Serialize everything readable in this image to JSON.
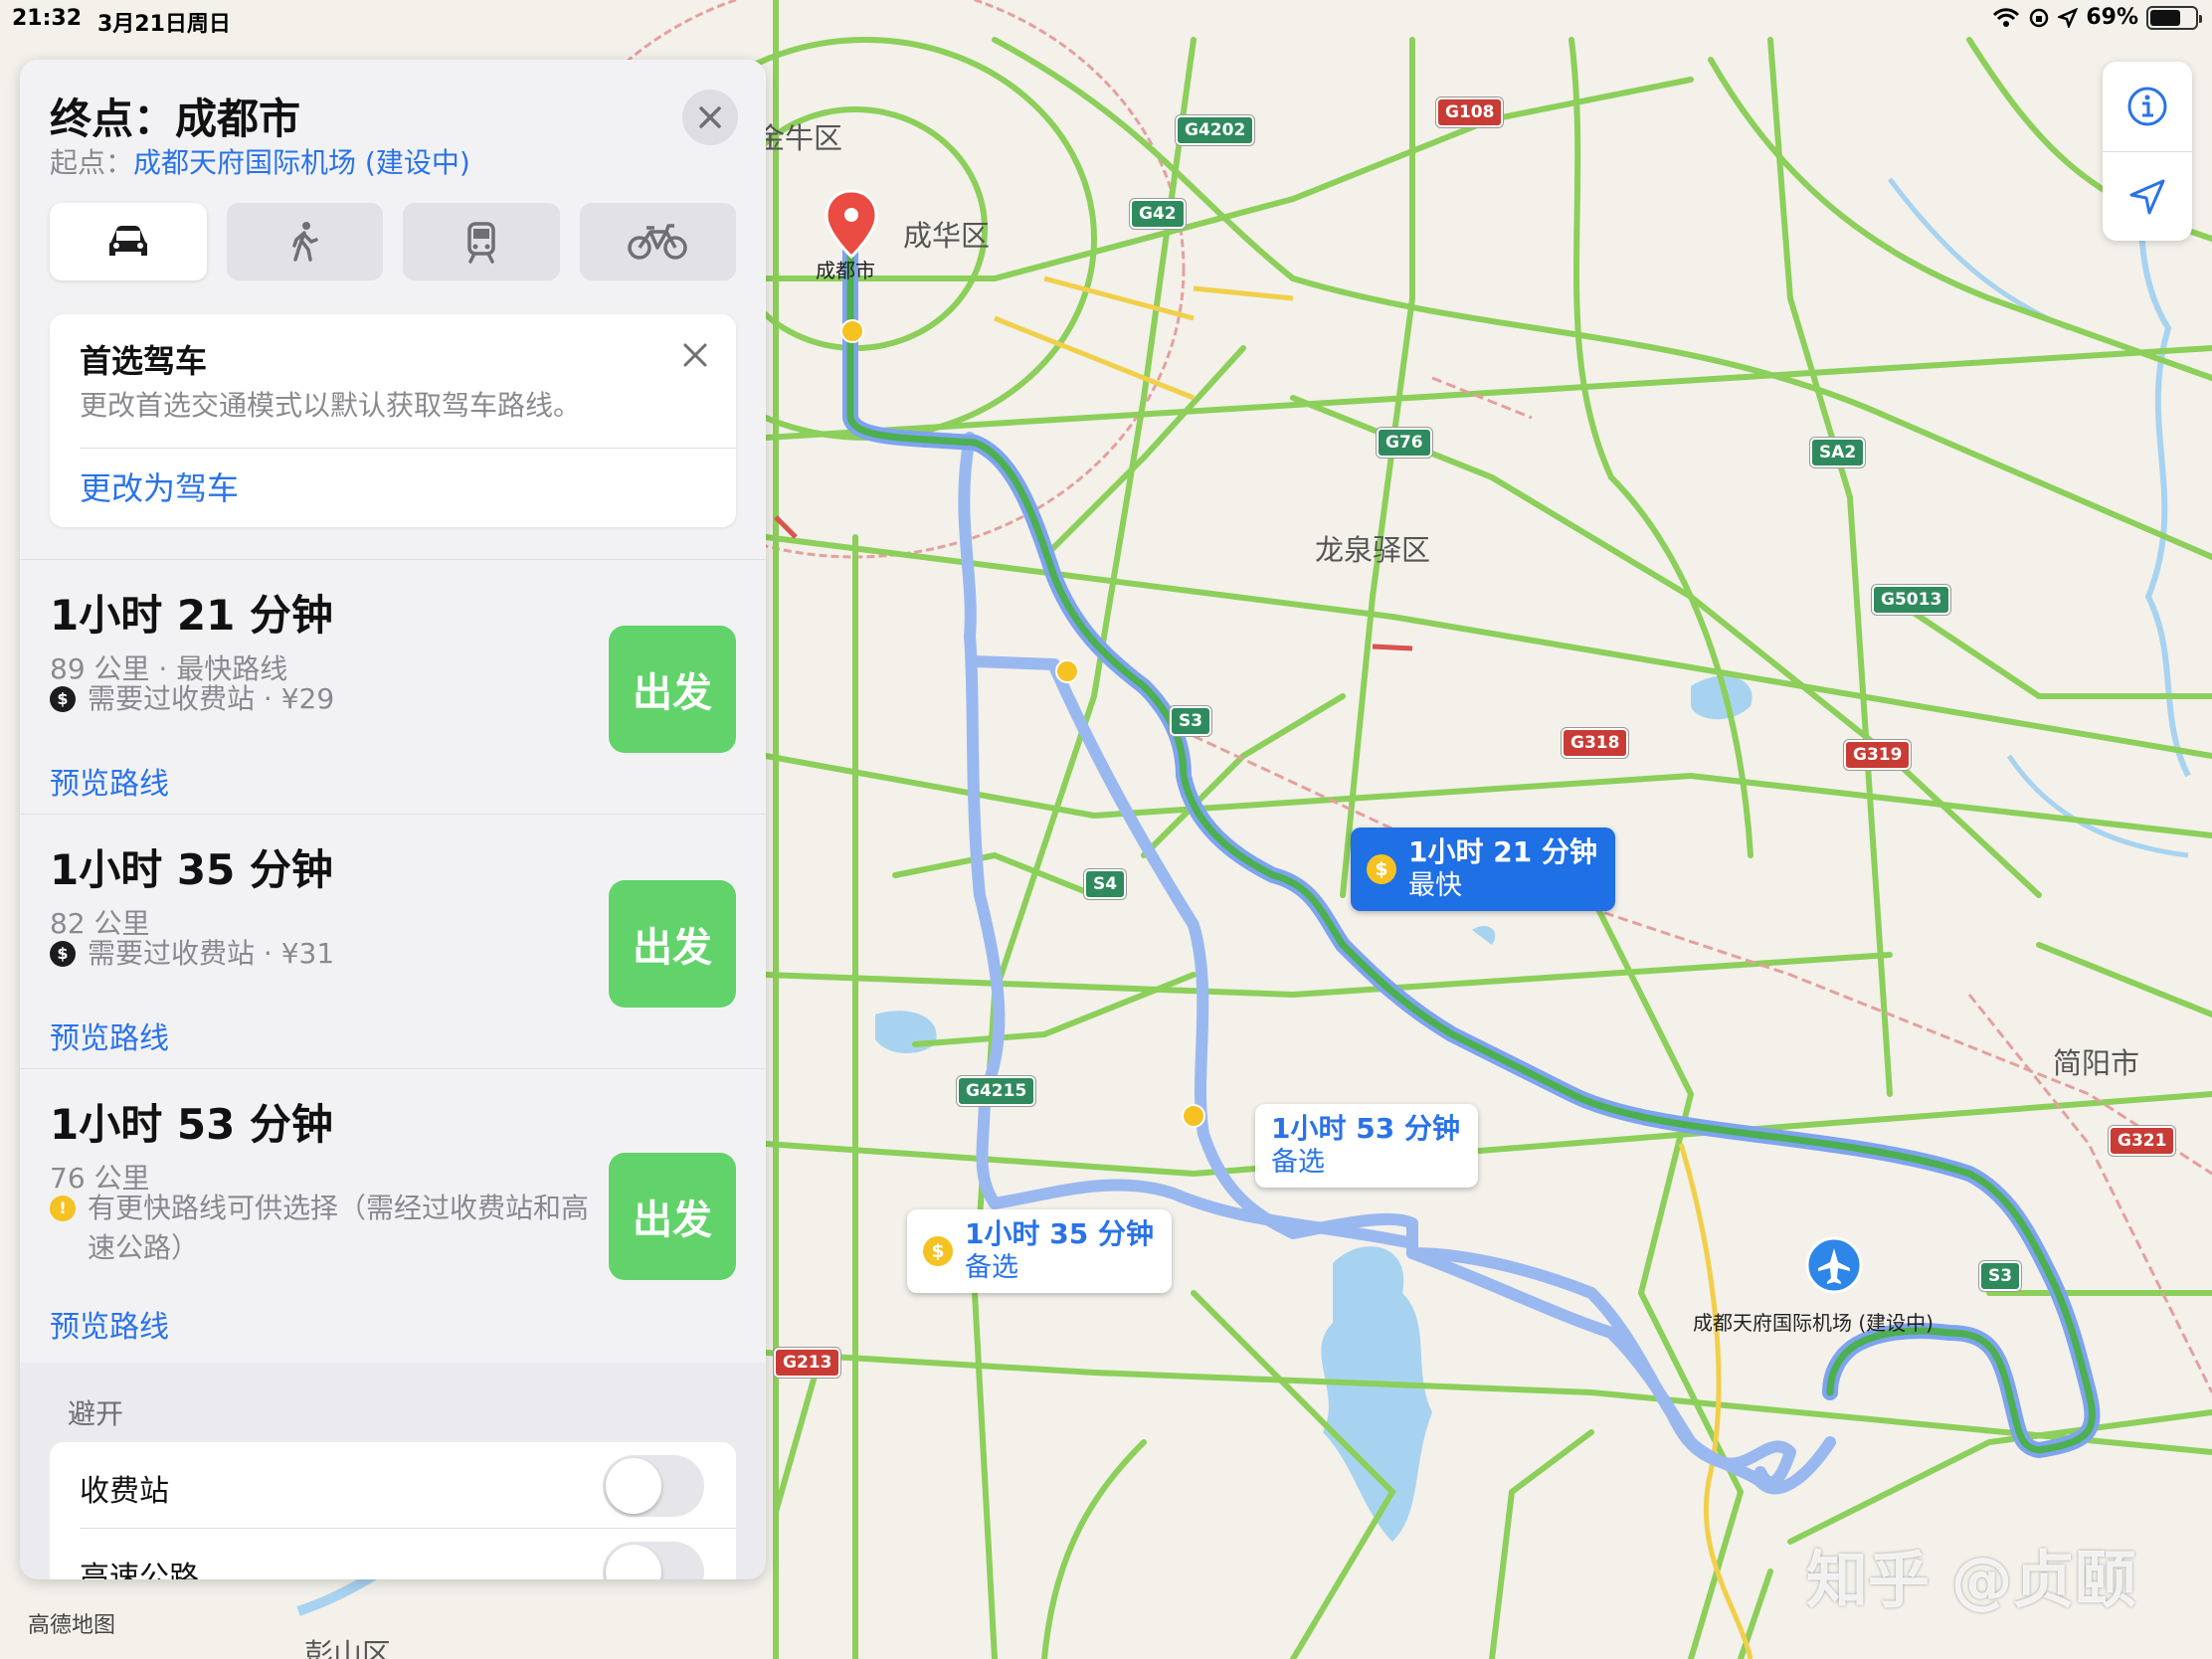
{
  "status_bar": {
    "time": "21:32",
    "date": "3月21日周日",
    "battery": "69%",
    "battery_level": 0.69
  },
  "panel": {
    "title": "终点：成都市",
    "origin_prefix": "起点：",
    "origin_name": "成都天府国际机场 (建设中)",
    "modes": [
      {
        "name": "drive",
        "icon": "car-icon",
        "active": true
      },
      {
        "name": "walk",
        "icon": "walk-icon",
        "active": false
      },
      {
        "name": "transit",
        "icon": "train-icon",
        "active": false
      },
      {
        "name": "cycle",
        "icon": "bicycle-icon",
        "active": false
      }
    ],
    "preference": {
      "title": "首选驾车",
      "description": "更改首选交通模式以默认获取驾车路线。",
      "action": "更改为驾车"
    },
    "routes": [
      {
        "time": "1小时 21 分钟",
        "distance": "89 公里 · 最快路线",
        "note": "需要过收费站 · ¥29",
        "note_type": "toll",
        "preview": "预览路线",
        "go": "出发"
      },
      {
        "time": "1小时 35 分钟",
        "distance": "82 公里",
        "note": "需要过收费站 · ¥31",
        "note_type": "toll",
        "preview": "预览路线",
        "go": "出发"
      },
      {
        "time": "1小时 53 分钟",
        "distance": "76 公里",
        "note": "有更快路线可供选择（需经过收费站和高速公路）",
        "note_type": "warning",
        "preview": "预览路线",
        "go": "出发"
      }
    ],
    "avoid": {
      "label": "避开",
      "options": [
        {
          "label": "收费站",
          "enabled": false
        },
        {
          "label": "高速公路",
          "enabled": false
        }
      ]
    }
  },
  "map": {
    "districts": [
      "金牛区",
      "成华区",
      "龙泉驿区",
      "简阳市",
      "彭山区"
    ],
    "destination_label": "成都市",
    "airport_label": "成都天府国际机场 (建设中)",
    "shields": [
      {
        "code": "G4202",
        "color": "green"
      },
      {
        "code": "G108",
        "color": "red"
      },
      {
        "code": "G42",
        "color": "green"
      },
      {
        "code": "G76",
        "color": "green"
      },
      {
        "code": "SA2",
        "color": "green"
      },
      {
        "code": "G5013",
        "color": "green"
      },
      {
        "code": "S3",
        "color": "green"
      },
      {
        "code": "G318",
        "color": "red"
      },
      {
        "code": "G319",
        "color": "red"
      },
      {
        "code": "S4",
        "color": "green"
      },
      {
        "code": "G4215",
        "color": "green"
      },
      {
        "code": "G321",
        "color": "red"
      },
      {
        "code": "S3",
        "color": "green"
      },
      {
        "code": "G213",
        "color": "red"
      }
    ],
    "callouts": [
      {
        "time": "1小时 21 分钟",
        "sub": "最快",
        "toll": true,
        "primary": true
      },
      {
        "time": "1小时 53 分钟",
        "sub": "备选",
        "toll": false,
        "primary": false
      },
      {
        "time": "1小时 35 分钟",
        "sub": "备选",
        "toll": true,
        "primary": false
      }
    ],
    "attribution": "高德地图",
    "watermark": "知乎 @贞颐"
  },
  "colors": {
    "accent": "#2a73e8",
    "go_button": "#62d36a",
    "route_primary": "#4caf50",
    "route_alt": "#9ab8f0"
  }
}
